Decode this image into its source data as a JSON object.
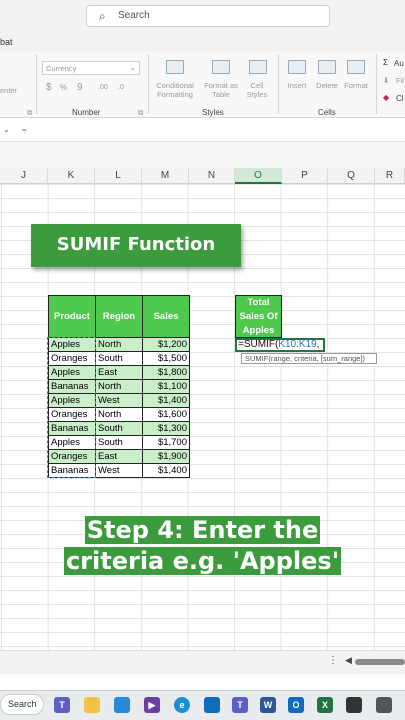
{
  "search": {
    "placeholder": "Search"
  },
  "ribbon_tab_fragment": "bat",
  "ribbon": {
    "number_format": "Currency",
    "alignment_fragment": "enter",
    "number_group": "Number",
    "styles_group": "Styles",
    "cells_group": "Cells",
    "conditional_formatting": "Conditional Formatting",
    "format_as_table": "Format as Table",
    "cell_styles": "Cell Styles",
    "insert": "Insert",
    "delete": "Delete",
    "format": "Format",
    "autosum_fragment": "Au",
    "fill_fragment": "Fil",
    "clear_fragment": "Cl"
  },
  "columns": [
    "J",
    "K",
    "L",
    "M",
    "N",
    "O",
    "P",
    "Q",
    "R"
  ],
  "active_column": "O",
  "title": "SUMIF Function",
  "table": {
    "headers": [
      "Product",
      "Region",
      "Sales"
    ],
    "rows": [
      [
        "Apples",
        "North",
        "$1,200"
      ],
      [
        "Oranges",
        "South",
        "$1,500"
      ],
      [
        "Apples",
        "East",
        "$1,800"
      ],
      [
        "Bananas",
        "North",
        "$1,100"
      ],
      [
        "Apples",
        "West",
        "$1,400"
      ],
      [
        "Oranges",
        "North",
        "$1,600"
      ],
      [
        "Bananas",
        "South",
        "$1,300"
      ],
      [
        "Apples",
        "South",
        "$1,700"
      ],
      [
        "Oranges",
        "East",
        "$1,900"
      ],
      [
        "Bananas",
        "West",
        "$1,400"
      ]
    ]
  },
  "total_header": "Total Sales Of Apples",
  "formula": {
    "prefix": "=SUMIF(",
    "ref": "K10:K19",
    "suffix": ","
  },
  "tooltip": "SUMIF(range, criteria, [sum_range])",
  "step_line1": "Step 4: Enter the",
  "step_line2": "criteria e.g. 'Apples'",
  "taskbar": {
    "search": "Search"
  },
  "colors": {
    "excel_green": "#217346",
    "header_green": "#4ec94e",
    "row_green": "#c9efc9",
    "banner_green": "#3c9b3c"
  }
}
